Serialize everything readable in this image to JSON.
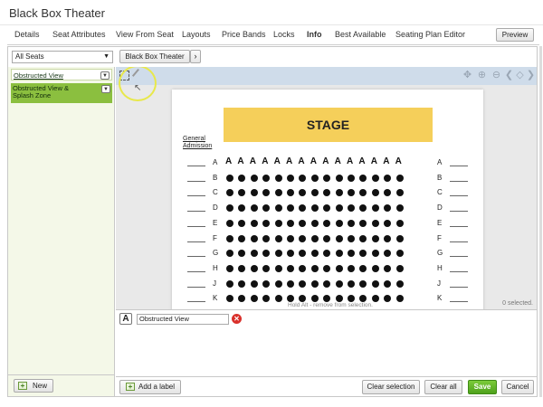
{
  "window": {
    "title": "Black Box Theater"
  },
  "tabs": [
    "Details",
    "Seat Attributes",
    "View From Seat",
    "Layouts",
    "Price Bands",
    "Locks",
    "Info",
    "Best Available",
    "Seating Plan Editor"
  ],
  "active_tab": "Info",
  "preview_label": "Preview",
  "filter": {
    "selected": "All Seats"
  },
  "breadcrumb": {
    "label": "Black Box Theater",
    "next": "›"
  },
  "zones": [
    {
      "label": "Obstructed View"
    },
    {
      "label": "Obstructed View & Splash Zone"
    }
  ],
  "left_footer": {
    "new_label": "New"
  },
  "seating": {
    "stage_label": "STAGE",
    "general_admission": "General Admission",
    "rows": [
      "A",
      "B",
      "C",
      "D",
      "E",
      "F",
      "G",
      "H",
      "J",
      "K"
    ],
    "seats_per_row": 15
  },
  "status": {
    "selected": "0 selected.",
    "hint": "Hold Alt - remove from selection."
  },
  "label_editor": {
    "value": "Obstructed View"
  },
  "bottom": {
    "add_label": "Add a label",
    "clear_selection": "Clear selection",
    "clear_all": "Clear all",
    "save": "Save",
    "cancel": "Cancel"
  },
  "icons": [
    "plus-icon",
    "selection-icon",
    "pencil-icon",
    "pan-icon",
    "zoom-in-icon",
    "zoom-out-icon",
    "arrow-left-icon",
    "fit-screen-icon",
    "arrow-right-icon",
    "delete-icon",
    "text-label-icon",
    "chevron-down-icon"
  ],
  "colors": {
    "stage": "#f5cf5a",
    "zone_active": "#8bbf3f",
    "save": "#5bb026",
    "toolbar": "#cfdcea"
  }
}
